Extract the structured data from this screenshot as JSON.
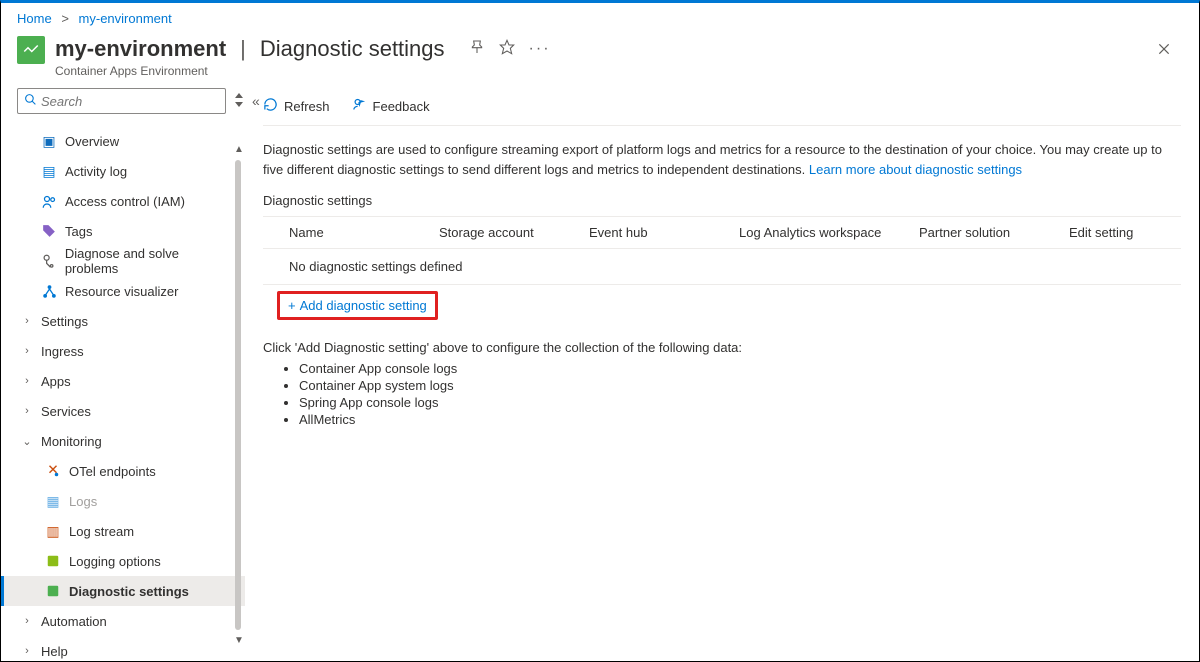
{
  "breadcrumb": {
    "home": "Home",
    "env": "my-environment"
  },
  "header": {
    "resource_name": "my-environment",
    "page_title": "Diagnostic settings",
    "subtitle": "Container Apps Environment"
  },
  "search": {
    "placeholder": "Search"
  },
  "nav": {
    "overview": "Overview",
    "activity": "Activity log",
    "iam": "Access control (IAM)",
    "tags": "Tags",
    "diagnose": "Diagnose and solve problems",
    "visualizer": "Resource visualizer",
    "settings": "Settings",
    "ingress": "Ingress",
    "apps": "Apps",
    "services": "Services",
    "monitoring": "Monitoring",
    "otel": "OTel endpoints",
    "logs": "Logs",
    "logstream": "Log stream",
    "loggingopts": "Logging options",
    "diagsettings": "Diagnostic settings",
    "automation": "Automation",
    "help": "Help"
  },
  "toolbar": {
    "refresh": "Refresh",
    "feedback": "Feedback"
  },
  "content": {
    "description": "Diagnostic settings are used to configure streaming export of platform logs and metrics for a resource to the destination of your choice. You may create up to five different diagnostic settings to send different logs and metrics to independent destinations. ",
    "learn_more": "Learn more about diagnostic settings",
    "section_title": "Diagnostic settings",
    "columns": {
      "name": "Name",
      "storage": "Storage account",
      "eventhub": "Event hub",
      "law": "Log Analytics workspace",
      "partner": "Partner solution",
      "edit": "Edit setting"
    },
    "empty_row": "No diagnostic settings defined",
    "add_label": "Add diagnostic setting",
    "hint": "Click 'Add Diagnostic setting' above to configure the collection of the following data:",
    "data_types": [
      "Container App console logs",
      "Container App system logs",
      "Spring App console logs",
      "AllMetrics"
    ]
  }
}
